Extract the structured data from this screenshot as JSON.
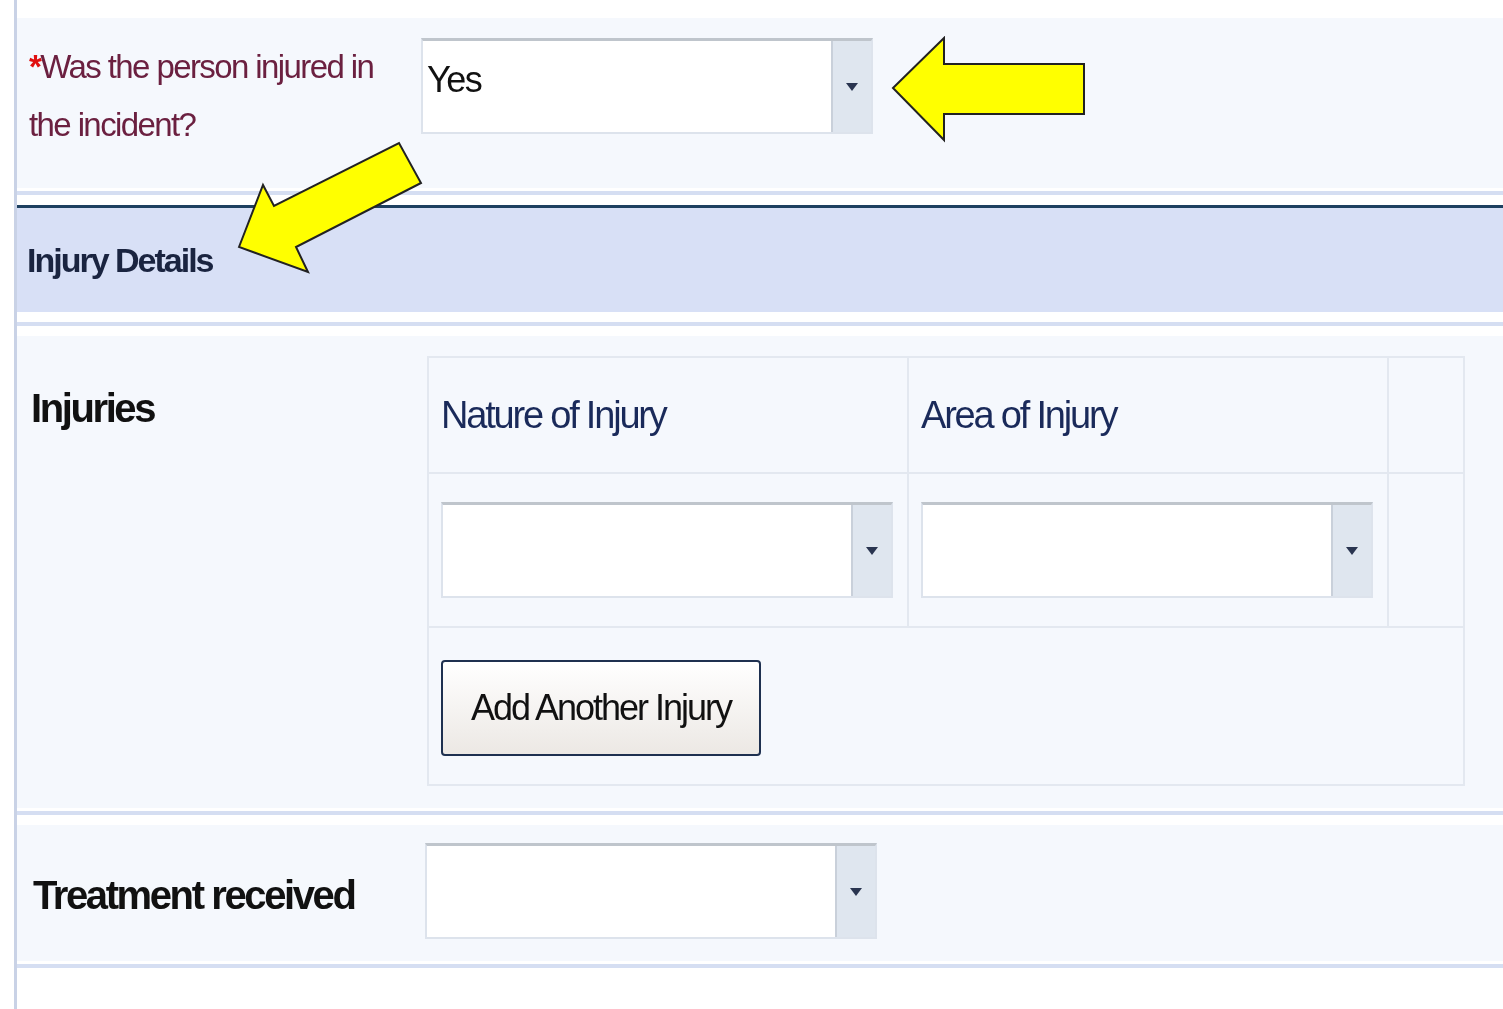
{
  "question": {
    "required_mark": "*",
    "label": "Was the person injured in the incident?",
    "value": "Yes"
  },
  "section": {
    "title": "Injury Details"
  },
  "injuries": {
    "label": "Injuries",
    "columns": [
      "Nature of Injury",
      "Area of Injury"
    ],
    "add_button": "Add Another Injury"
  },
  "treatment": {
    "label": "Treatment received"
  }
}
